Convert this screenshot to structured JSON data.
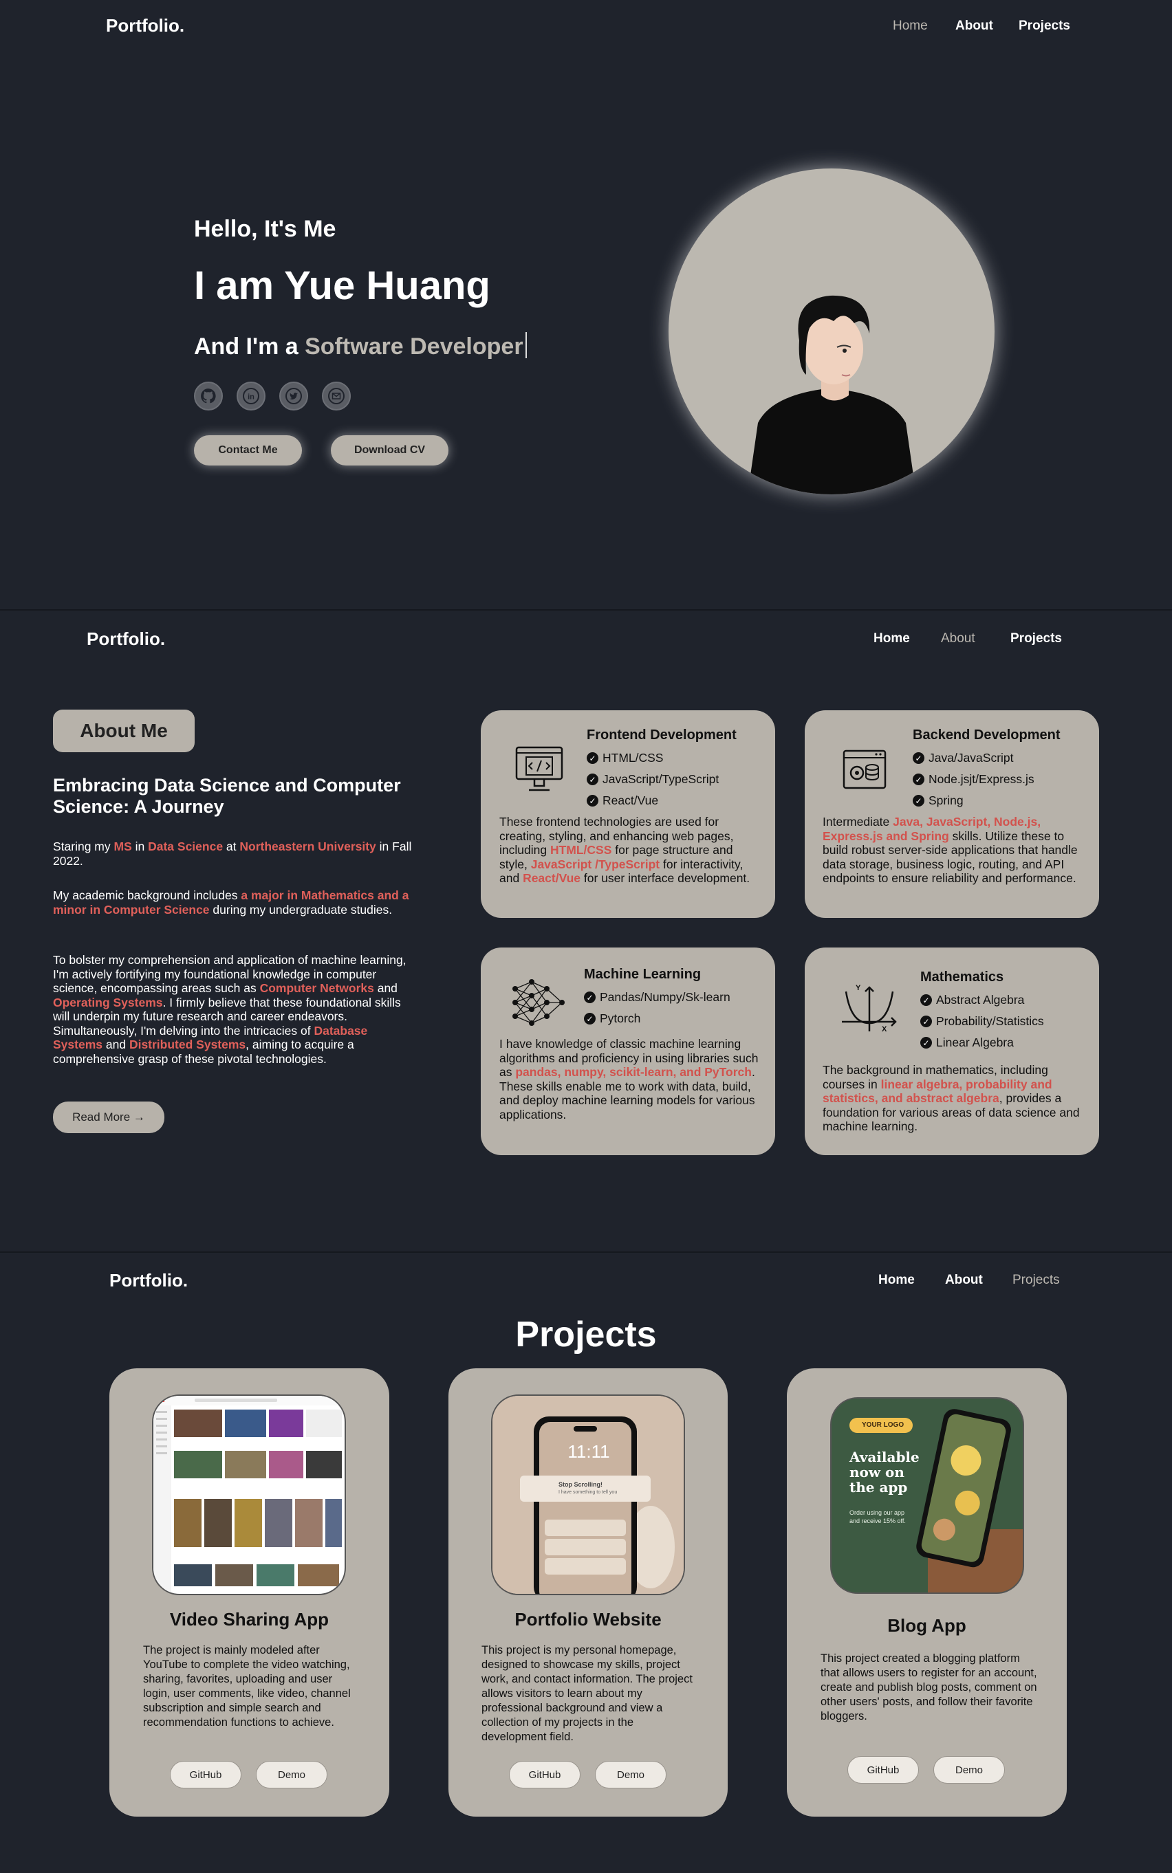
{
  "nav": {
    "logo": "Portfolio.",
    "home": "Home",
    "about": "About",
    "projects": "Projects"
  },
  "hero": {
    "greeting": "Hello, It's Me",
    "name": "I am Yue Huang",
    "role_prefix": "And I'm a",
    "role": "Software Developer",
    "social_icons": [
      "github-icon",
      "linkedin-icon",
      "twitter-icon",
      "mail-icon"
    ],
    "contact_label": "Contact Me",
    "cv_label": "Download CV"
  },
  "about": {
    "badge": "About Me",
    "title": "Embracing Data Science and Computer Science: A Journey",
    "p1": {
      "a": "Staring my ",
      "b": "MS",
      "c": " in ",
      "d": "Data Science",
      "e": " at ",
      "f": "Northeastern University",
      "g": " in Fall 2022."
    },
    "p2": {
      "a": "My academic background includes ",
      "b": "a major in Mathematics and a minor in Computer Science",
      "c": " during my undergraduate studies."
    },
    "p3": {
      "a": "To bolster my comprehension and application of machine learning, I'm actively fortifying my foundational knowledge in computer science, encompassing areas such as ",
      "b": "Computer Networks",
      "c": " and ",
      "d": "Operating Systems",
      "e": ". I firmly believe that these foundational skills will underpin my future research and career endeavors. Simultaneously, I'm delving into the intricacies of ",
      "f": "Database Systems",
      "g": " and ",
      "h": "Distributed Systems",
      "i": ", aiming to acquire a comprehensive grasp of these pivotal technologies."
    },
    "read_more": "Read More →"
  },
  "skills": {
    "frontend": {
      "title": "Frontend Development",
      "items": [
        "HTML/CSS",
        "JavaScript/TypeScript",
        "React/Vue"
      ],
      "desc": {
        "a": "These frontend technologies are used for creating, styling, and enhancing web pages, including ",
        "b": "HTML/CSS",
        "c": " for page structure and style, ",
        "d": "JavaScript /TypeScript",
        "e": " for interactivity, and ",
        "f": "React/Vue",
        "g": " for user interface development."
      }
    },
    "backend": {
      "title": "Backend Development",
      "items": [
        "Java/JavaScript",
        "Node.jsjt/Express.js",
        "Spring"
      ],
      "desc": {
        "a": "Intermediate ",
        "b": "Java, JavaScript, Node.js, Express.js and Spring",
        "c": " skills. Utilize these to build robust server-side applications that handle data storage, business logic, routing, and API endpoints to ensure reliability and performance."
      }
    },
    "ml": {
      "title": "Machine Learning",
      "items": [
        "Pandas/Numpy/Sk-learn",
        "Pytorch"
      ],
      "desc": {
        "a": "I have knowledge of classic machine learning algorithms and proficiency in using libraries such as ",
        "b": "pandas, numpy, scikit-learn, and PyTorch",
        "c": ". These skills enable me to work with data, build, and deploy machine learning models for various applications."
      }
    },
    "math": {
      "title": "Mathematics",
      "items": [
        "Abstract Algebra",
        "Probability/Statistics",
        "Linear Algebra"
      ],
      "desc": {
        "a": "The background in mathematics, including courses in ",
        "b": "linear algebra, probability and statistics, and abstract algebra",
        "c": ", provides a foundation for various areas of data science and machine learning."
      }
    }
  },
  "projects": {
    "heading": "Projects",
    "items": [
      {
        "title": "Video Sharing App",
        "desc": "The project is mainly modeled after YouTube to complete the video watching, sharing, favorites, uploading and user login, user comments, like video, channel subscription and simple search and recommendation functions to achieve.",
        "github": "GitHub",
        "demo": "Demo"
      },
      {
        "title": "Portfolio Website",
        "desc": "This project is my personal homepage, designed to showcase my skills, project work, and contact information. The project allows visitors to learn about my professional background and view a collection of my projects in the development field.",
        "github": "GitHub",
        "demo": "Demo",
        "phone_time": "11:11",
        "notif_title": "Stop Scrolling!",
        "notif_sub": "I have something to tell you"
      },
      {
        "title": "Blog App",
        "desc": "This project created a blogging platform that allows users to register for an account, create and publish blog posts, comment on other users' posts, and follow their favorite bloggers.",
        "github": "GitHub",
        "demo": "Demo",
        "promo_logo": "YOUR LOGO",
        "promo_title": "Available now on the app",
        "promo_sub": "Order using our app and receive 15% off."
      }
    ]
  },
  "colors": {
    "background": "#1f232c",
    "card": "#b7b2aa",
    "accent": "#e0605a"
  }
}
